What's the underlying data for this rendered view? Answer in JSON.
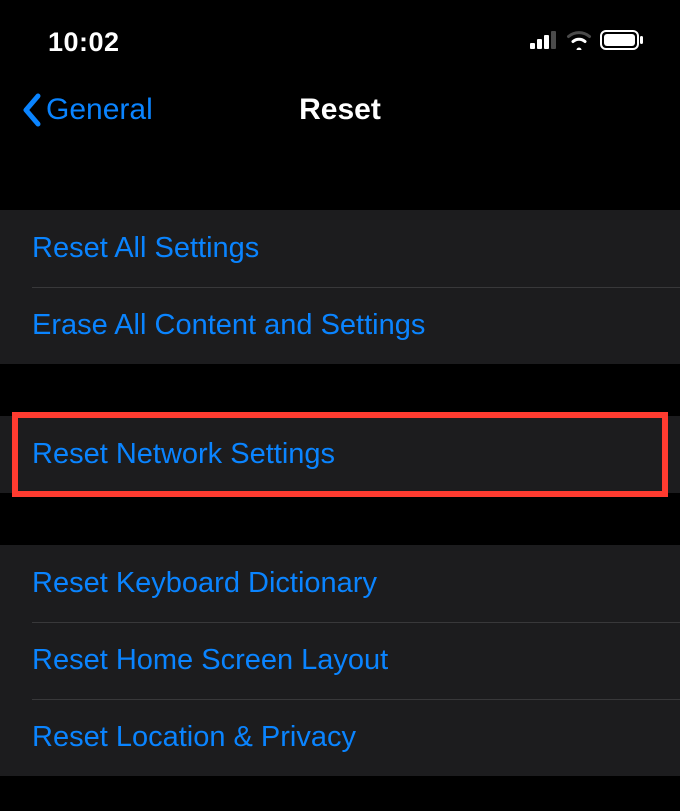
{
  "statusBar": {
    "time": "10:02"
  },
  "nav": {
    "backLabel": "General",
    "title": "Reset"
  },
  "sections": {
    "group1": {
      "item0": "Reset All Settings",
      "item1": "Erase All Content and Settings"
    },
    "group2": {
      "item0": "Reset Network Settings"
    },
    "group3": {
      "item0": "Reset Keyboard Dictionary",
      "item1": "Reset Home Screen Layout",
      "item2": "Reset Location & Privacy"
    }
  }
}
